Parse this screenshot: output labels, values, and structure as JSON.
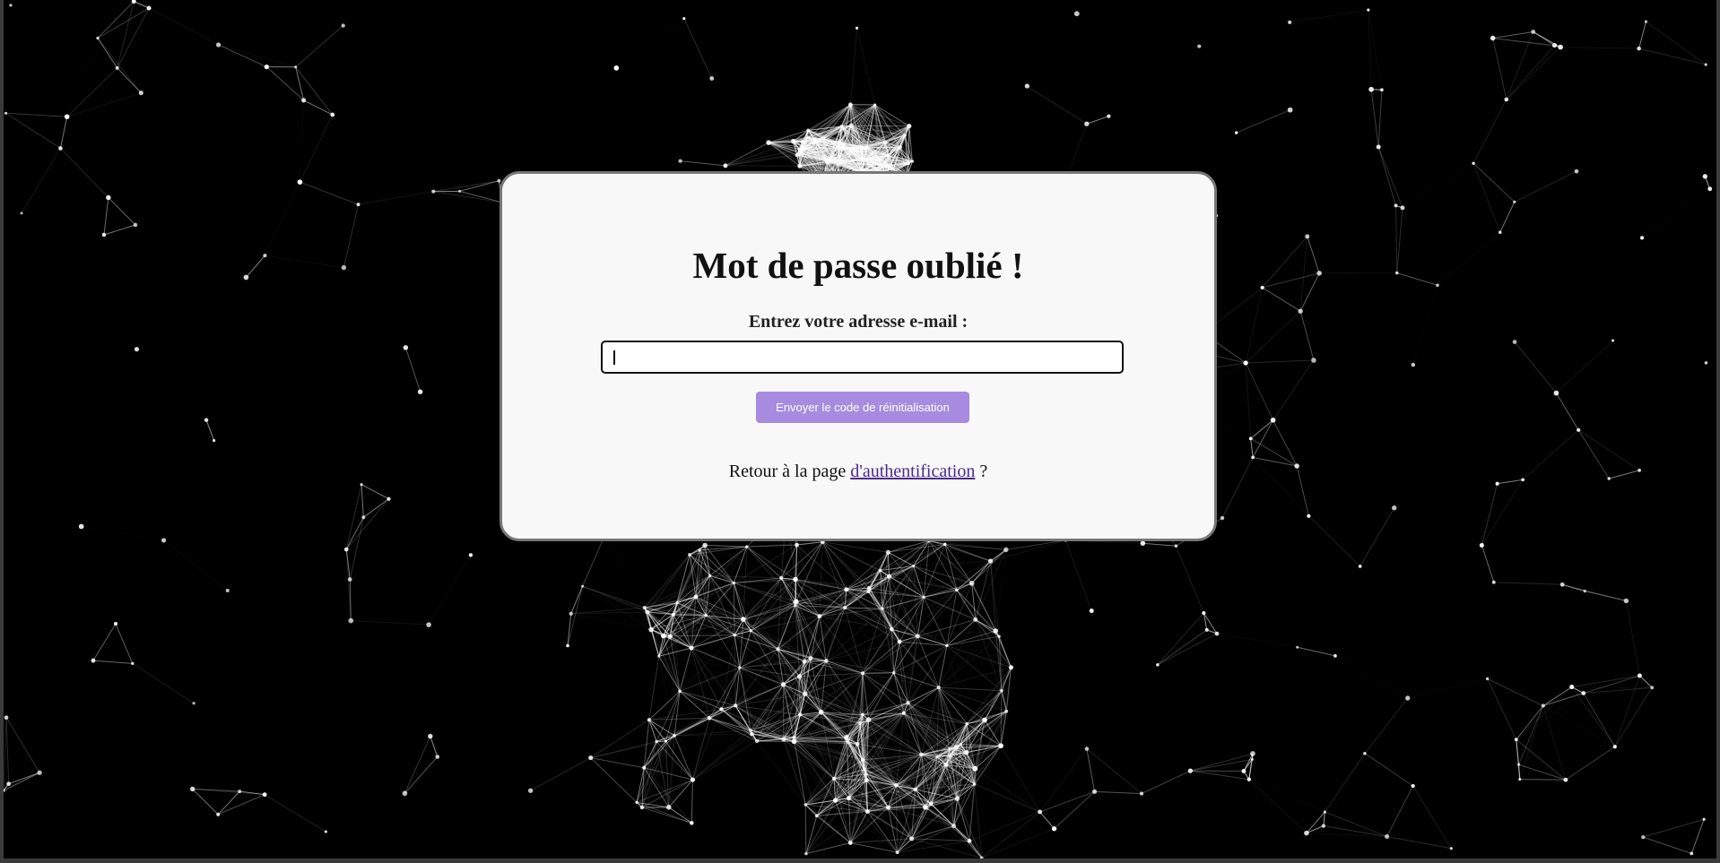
{
  "page": {
    "title": "Mot de passe oublié !",
    "email_label": "Entrez votre adresse e-mail :",
    "email_value": "",
    "email_placeholder": "",
    "submit_label": "Envoyer le code de réinitialisation",
    "back_prefix": "Retour à la page",
    "back_link_label": "d'authentification",
    "back_suffix": "?"
  },
  "colors": {
    "background": "#000000",
    "card": "#f8f8f8",
    "card_border": "#777777",
    "button": "#a78be0",
    "link": "#4b2a8a",
    "particle": "#ffffff"
  }
}
